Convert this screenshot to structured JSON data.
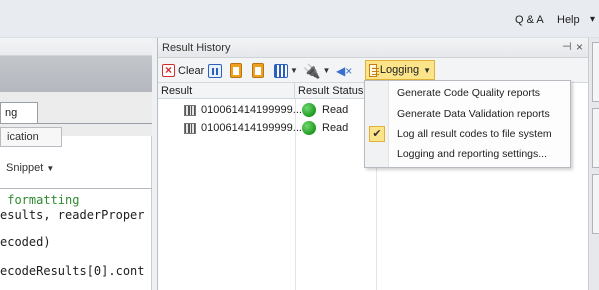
{
  "menubar": {
    "qa": "Q & A",
    "help": "Help"
  },
  "left_pane": {
    "tab_active": "ng",
    "tab_second": "ication",
    "snippet": "Snippet",
    "code_lines": [
      " formatting",
      "esults, readerProper",
      "ecoded)",
      "ecodeResults[0].cont"
    ]
  },
  "result_history": {
    "title": "Result History",
    "pin": "⊣⊢",
    "close": "×",
    "toolbar": {
      "clear": "Clear",
      "logging": "Logging"
    },
    "columns": [
      "Result",
      "Result Status"
    ],
    "rows": [
      {
        "code": "010061414199999...",
        "status": "Read",
        "status_color": "#1f9a1f"
      },
      {
        "code": "010061414199999...",
        "status": "Read",
        "status_color": "#1f9a1f"
      }
    ]
  },
  "logging_menu": {
    "items": [
      {
        "label": "Generate Code Quality reports",
        "checked": false
      },
      {
        "label": "Generate Data Validation reports",
        "checked": false
      },
      {
        "label": "Log all result codes to file system",
        "checked": true
      },
      {
        "label": "Logging and reporting settings...",
        "checked": false
      }
    ]
  },
  "icons": {
    "clear": "clear-x-icon",
    "pause": "pause-icon",
    "copy": "copy-icon",
    "copy2": "copy-all-icon",
    "columns": "columns-icon",
    "antenna": "antenna-icon",
    "mute": "speaker-mute-icon",
    "logging": "logging-icon",
    "check": "check-icon",
    "barcode": "barcode-icon",
    "status": "status-dot-icon"
  },
  "colors": {
    "accent": "#fbe48a",
    "accent_border": "#e2b236",
    "code_comment": "#2f8a2f"
  }
}
